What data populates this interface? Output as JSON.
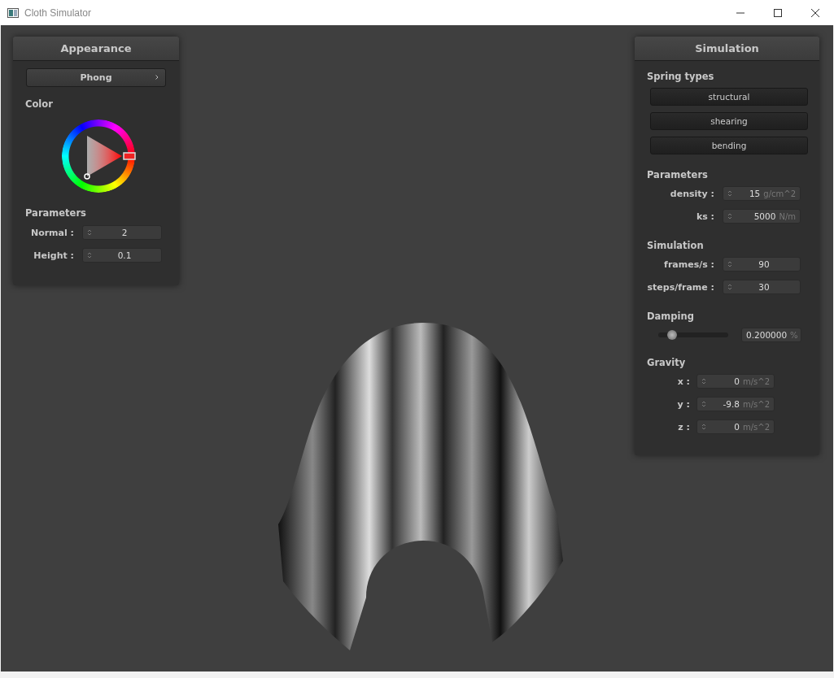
{
  "window": {
    "title": "Cloth Simulator"
  },
  "appearance": {
    "title": "Appearance",
    "shading": {
      "value": "Phong"
    },
    "color_label": "Color",
    "params_label": "Parameters",
    "fields": [
      {
        "label": "Normal :",
        "value": "2"
      },
      {
        "label": "Height :",
        "value": "0.1"
      }
    ]
  },
  "simulation": {
    "title": "Simulation",
    "sections": [
      {
        "kind": "buttons",
        "title": "Spring types",
        "buttons": [
          "structural",
          "shearing",
          "bending"
        ]
      },
      {
        "kind": "fields",
        "title": "Parameters",
        "fields": [
          {
            "label": "density :",
            "value": "15",
            "unit": "g/cm^2"
          },
          {
            "label": "ks :",
            "value": "5000",
            "unit": "N/m"
          }
        ]
      },
      {
        "kind": "fields",
        "title": "Simulation",
        "fields": [
          {
            "label": "frames/s :",
            "value": "90"
          },
          {
            "label": "steps/frame :",
            "value": "30"
          }
        ]
      },
      {
        "kind": "slider",
        "title": "Damping",
        "level": 0.2,
        "value": "0.200000",
        "unit": "%"
      },
      {
        "kind": "compact_fields",
        "title": "Gravity",
        "fields": [
          {
            "label": "x :",
            "value": "0",
            "unit": "m/s^2"
          },
          {
            "label": "y :",
            "value": "-9.8",
            "unit": "m/s^2"
          },
          {
            "label": "z :",
            "value": "0",
            "unit": "m/s^2"
          }
        ]
      }
    ]
  }
}
